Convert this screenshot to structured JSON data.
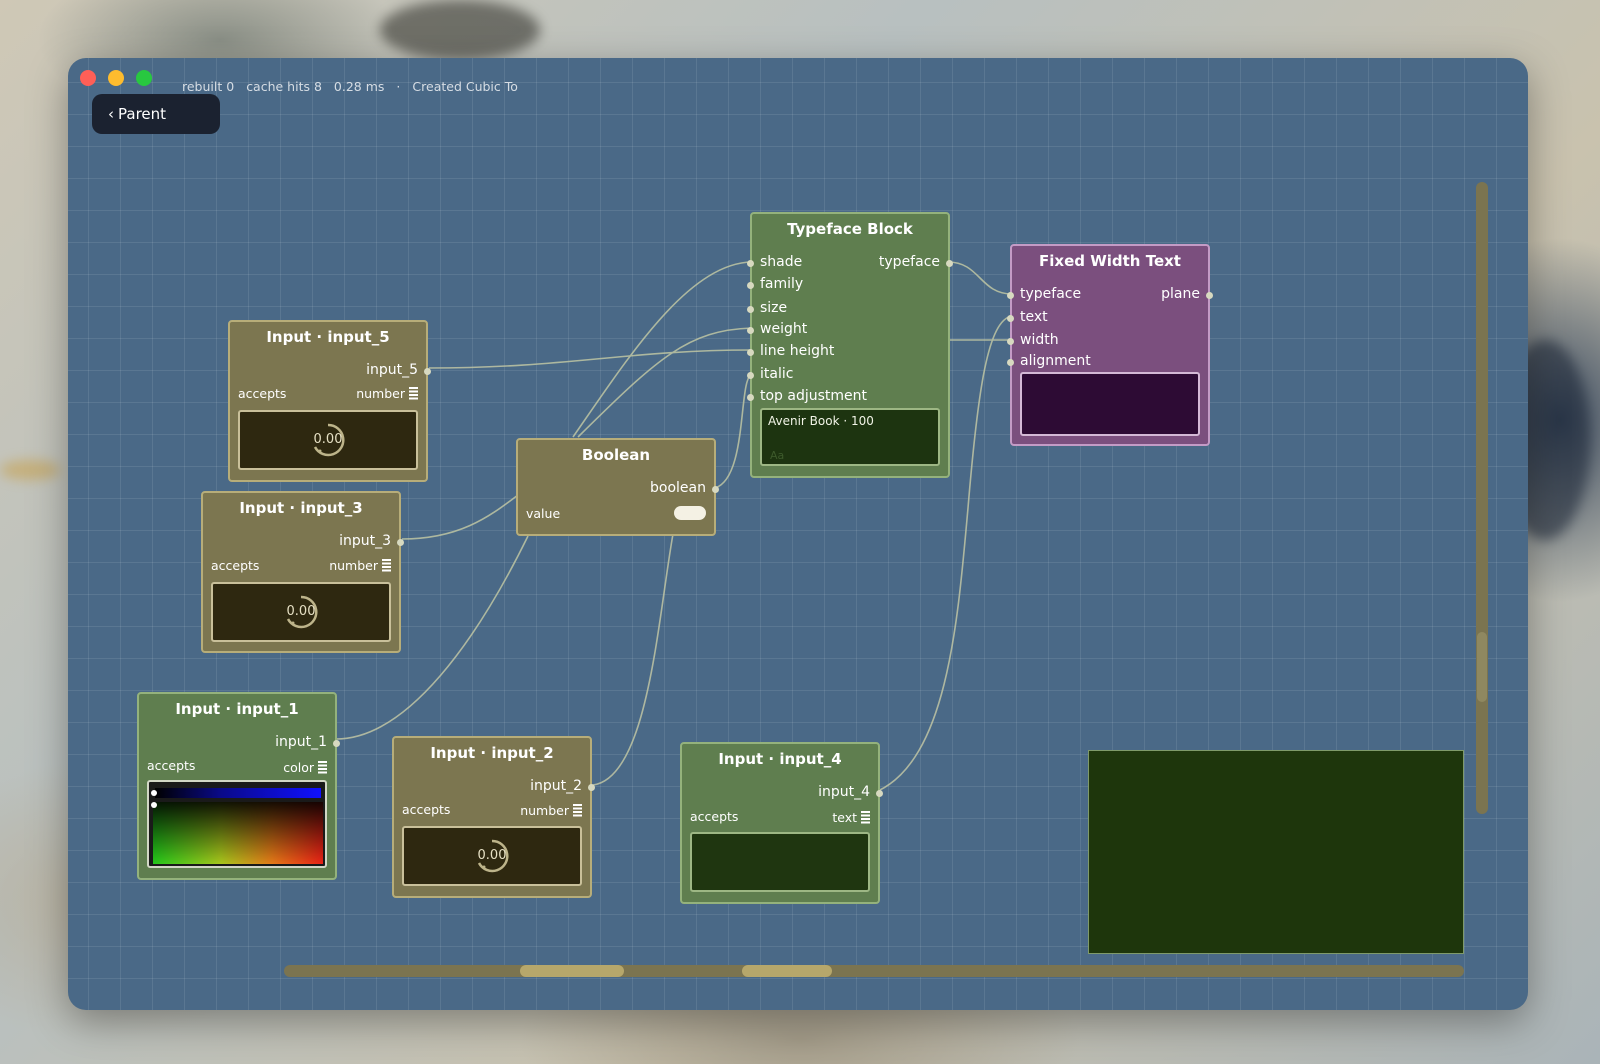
{
  "window": {
    "status": {
      "rebuilt": "rebuilt 0",
      "cache_hits": "cache hits 8",
      "time": "0.28 ms",
      "separator": "·",
      "message": "Created Cubic To"
    },
    "parent_button": {
      "chevron": "‹",
      "label": "Parent"
    }
  },
  "nodes": {
    "input_5": {
      "title": "Input · input_5",
      "output": "input_5",
      "accepts_label": "accepts",
      "accepts_type": "number",
      "value": "0.00"
    },
    "input_3": {
      "title": "Input · input_3",
      "output": "input_3",
      "accepts_label": "accepts",
      "accepts_type": "number",
      "value": "0.00"
    },
    "input_1": {
      "title": "Input · input_1",
      "output": "input_1",
      "accepts_label": "accepts",
      "accepts_type": "color"
    },
    "input_2": {
      "title": "Input · input_2",
      "output": "input_2",
      "accepts_label": "accepts",
      "accepts_type": "number",
      "value": "0.00"
    },
    "input_4": {
      "title": "Input · input_4",
      "output": "input_4",
      "accepts_label": "accepts",
      "accepts_type": "text"
    },
    "boolean": {
      "title": "Boolean",
      "output": "boolean",
      "value_label": "value"
    },
    "typeface_block": {
      "title": "Typeface Block",
      "output": "typeface",
      "inputs": [
        "shade",
        "family",
        "size",
        "weight",
        "line height",
        "italic",
        "top adjustment"
      ],
      "preview_label": "Avenir Book  ·  100",
      "preview_glyph": "Aa"
    },
    "fixed_width_text": {
      "title": "Fixed Width Text",
      "output": "plane",
      "inputs": [
        "typeface",
        "text",
        "width",
        "alignment"
      ]
    }
  },
  "colors": {
    "canvas": "#4a6987",
    "olive_node": "#7c7650",
    "green_node": "#5f7e4f",
    "purple_node": "#7b4f7e",
    "wire": "#bfc6a4"
  },
  "icons": [
    "type-stack-icon",
    "dial-icon",
    "chevron-left-icon"
  ]
}
